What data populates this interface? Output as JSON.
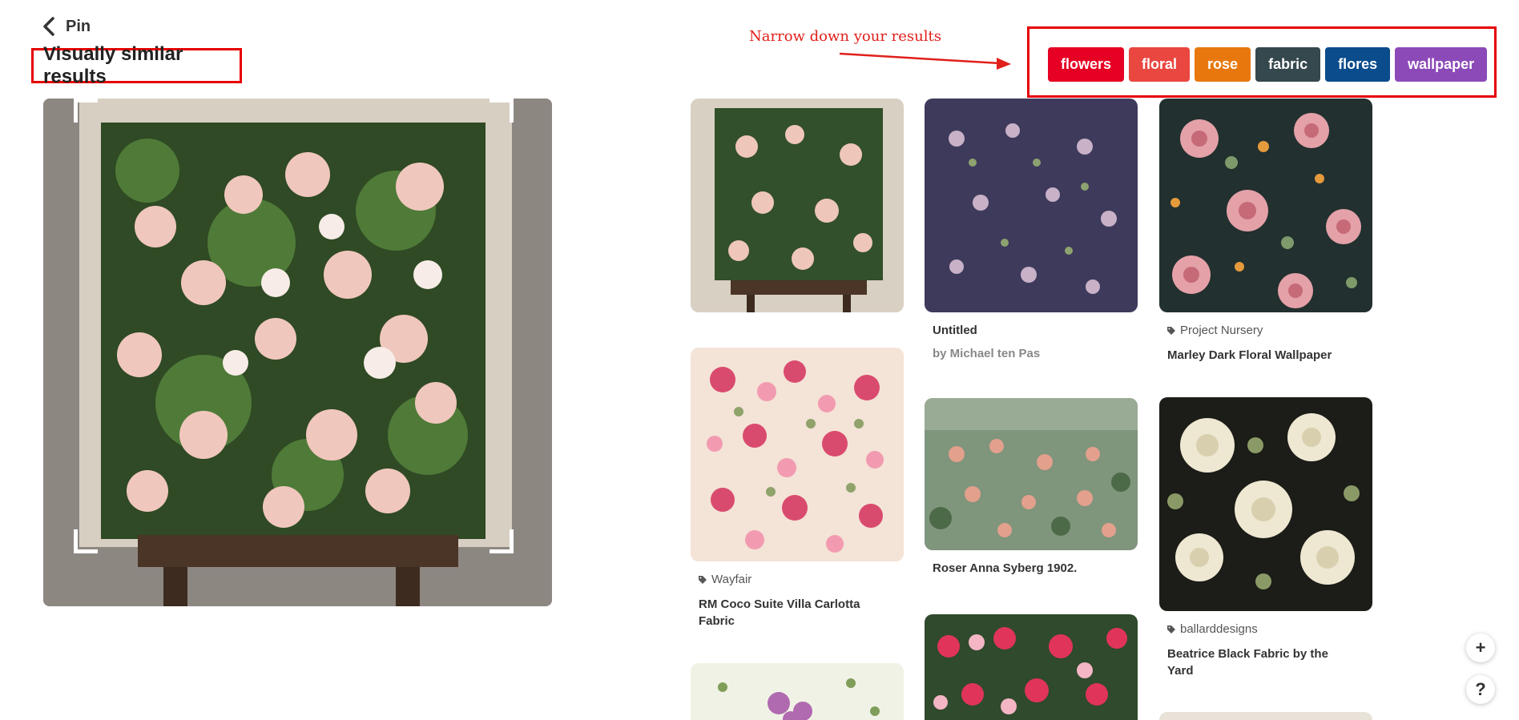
{
  "header": {
    "back_label": "Pin",
    "title": "Visually similar results"
  },
  "annotation": {
    "text": "Narrow down your results",
    "color": "#e0201b"
  },
  "filters": [
    {
      "label": "flowers",
      "color": "#e60023"
    },
    {
      "label": "floral",
      "color": "#e94740"
    },
    {
      "label": "rose",
      "color": "#e8780e"
    },
    {
      "label": "fabric",
      "color": "#34484d"
    },
    {
      "label": "flores",
      "color": "#0a4c8c"
    },
    {
      "label": "wallpaper",
      "color": "#8c4ab8"
    }
  ],
  "pins": [
    {
      "source": "",
      "title": "",
      "subtitle": ""
    },
    {
      "source": "Wayfair",
      "title": "RM Coco Suite Villa Carlotta Fabric",
      "subtitle": ""
    },
    {
      "source": "",
      "title": "",
      "subtitle": ""
    },
    {
      "source": "",
      "title": "Untitled",
      "subtitle": "by Michael ten Pas"
    },
    {
      "source": "",
      "title": "Roser Anna Syberg 1902.",
      "subtitle": ""
    },
    {
      "source": "",
      "title": "",
      "subtitle": ""
    },
    {
      "source": "Project Nursery",
      "title": "Marley Dark Floral Wallpaper",
      "subtitle": ""
    },
    {
      "source": "ballarddesigns",
      "title": "Beatrice Black Fabric by the Yard",
      "subtitle": ""
    },
    {
      "source": "",
      "title": "",
      "subtitle": ""
    }
  ],
  "fab": {
    "plus": "+",
    "help": "?"
  }
}
